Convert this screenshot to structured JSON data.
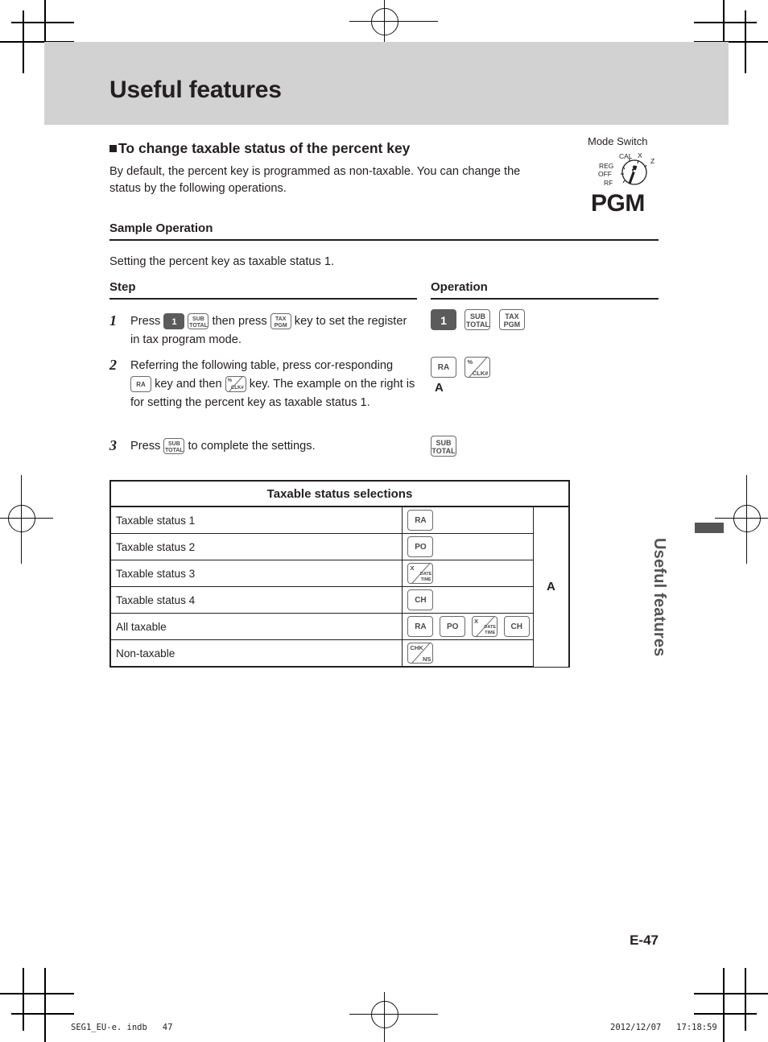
{
  "page": {
    "title": "Useful features",
    "side_tab": "Useful features",
    "page_number": "E-47",
    "footer_left": "SEG1_EU-e. indb   47",
    "footer_right": "2012/12/07   17:18:59"
  },
  "section": {
    "heading": "To change taxable status of the percent key",
    "body": "By default, the percent key is programmed as non-taxable. You can change the status by the following operations."
  },
  "mode_switch": {
    "label": "Mode Switch",
    "selected": "PGM",
    "positions": [
      "CAL",
      "X",
      "Z",
      "REG",
      "OFF",
      "RF"
    ]
  },
  "sample": {
    "heading": "Sample Operation",
    "intro": "Setting the percent key as taxable status 1.",
    "col_step": "Step",
    "col_operation": "Operation"
  },
  "steps": [
    {
      "num": "1",
      "text_a": "Press",
      "text_b": "then press",
      "text_c": "key to set the register in tax program mode."
    },
    {
      "num": "2",
      "text_a": "Referring the following table, press cor-responding",
      "text_b": "key and then",
      "text_c": "key. The example on the right is for setting the percent key as taxable status 1."
    },
    {
      "num": "3",
      "text_a": "Press",
      "text_b": "to complete the settings."
    }
  ],
  "keys": {
    "one": "1",
    "sub": "SUB",
    "total": "TOTAL",
    "tax": "TAX",
    "pgm": "PGM",
    "ra": "RA",
    "po": "PO",
    "ch": "CH",
    "percent": "%",
    "clk": "CLK#",
    "x": "X",
    "date": "DATE",
    "time": "TIME",
    "chk": "CHK",
    "ns": "NS"
  },
  "operation": {
    "step2_marker": "A"
  },
  "table": {
    "header": "Taxable status selections",
    "a_column": "A",
    "rows": [
      {
        "label": "Taxable status 1",
        "keys": [
          "RA"
        ]
      },
      {
        "label": "Taxable status 2",
        "keys": [
          "PO"
        ]
      },
      {
        "label": "Taxable status 3",
        "keys": [
          "X/DATE/TIME"
        ]
      },
      {
        "label": "Taxable status 4",
        "keys": [
          "CH"
        ]
      },
      {
        "label": "All taxable",
        "keys": [
          "RA",
          "PO",
          "X/DATE/TIME",
          "CH"
        ]
      },
      {
        "label": "Non-taxable",
        "keys": [
          "CHK/NS"
        ]
      }
    ]
  },
  "colors": {
    "header_band": "#d2d2d2",
    "text": "#231f20",
    "key_dark": "#5b5b5b",
    "side_tab": "#555555"
  }
}
